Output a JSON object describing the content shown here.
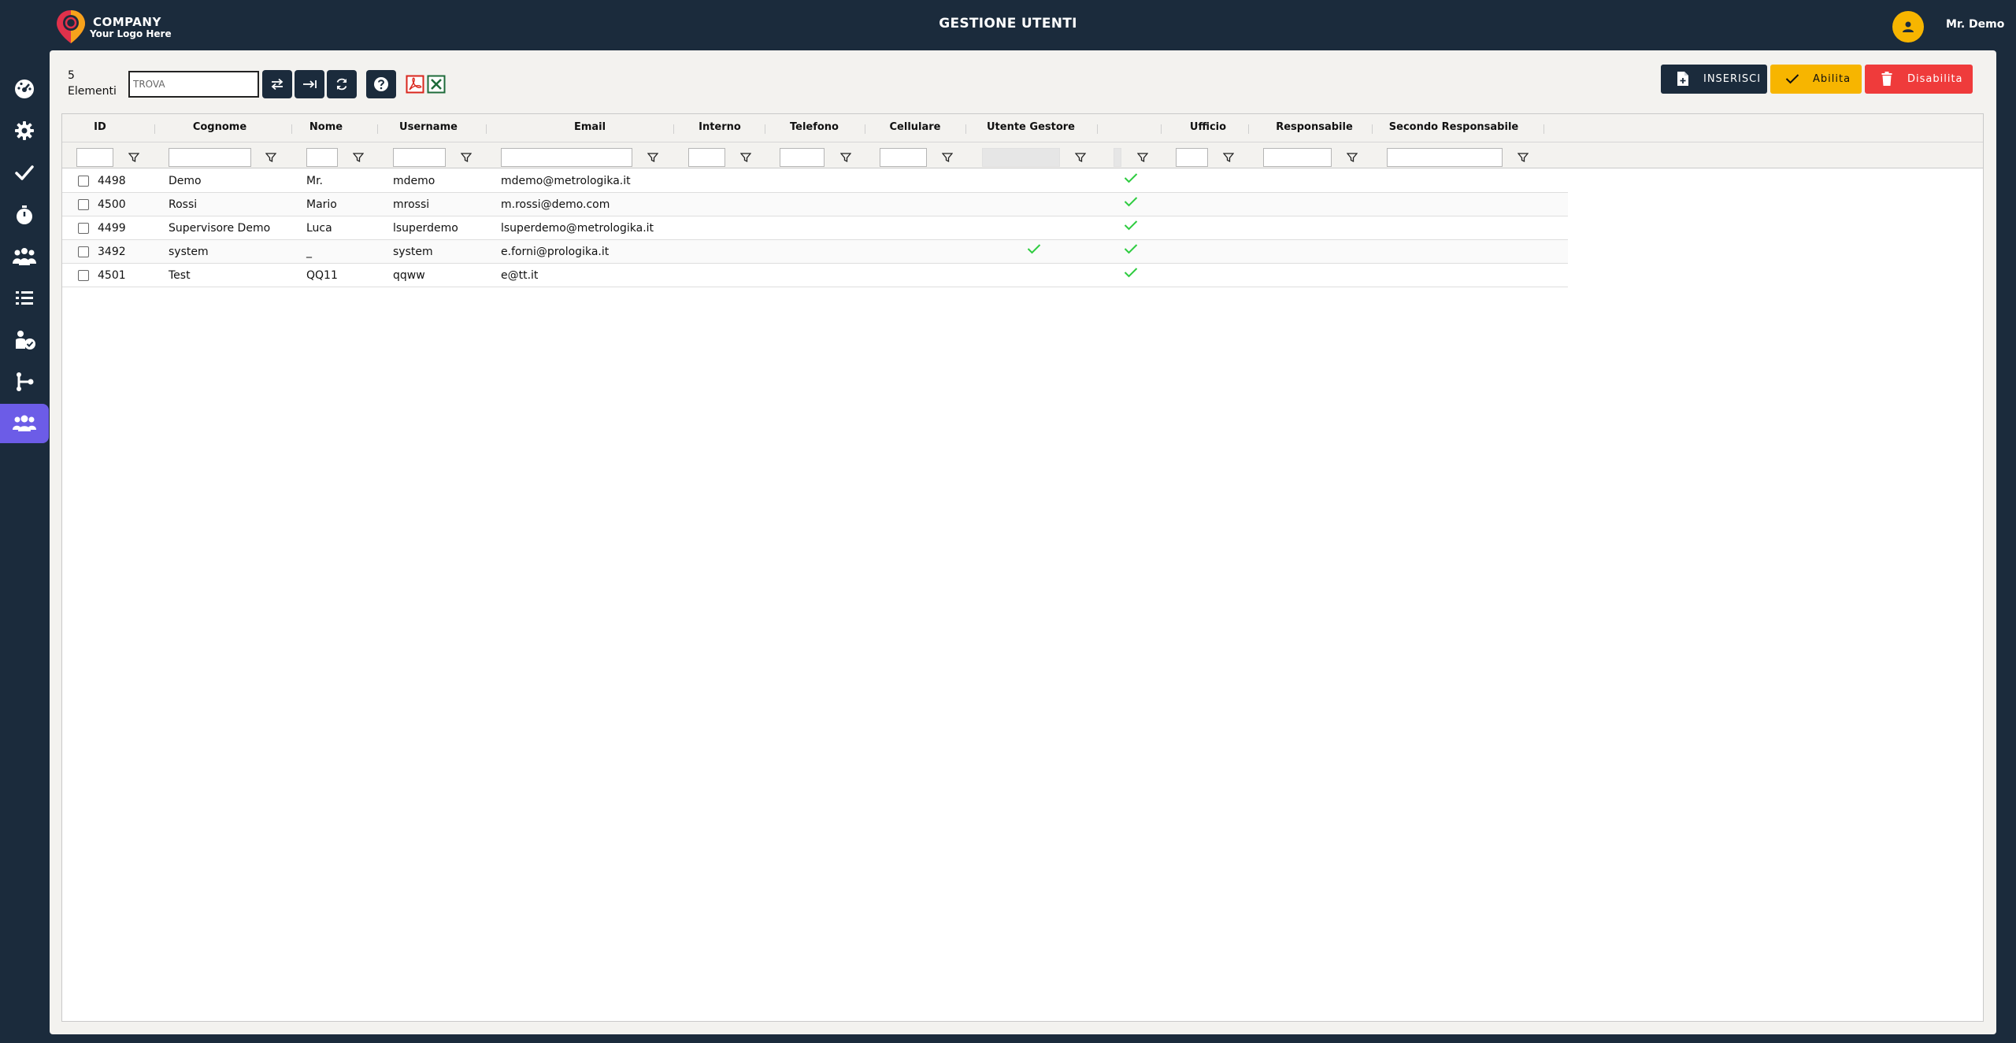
{
  "header": {
    "company": "COMPANY",
    "logo_tagline": "Your Logo Here",
    "title": "GESTIONE UTENTI",
    "user_name": "Mr. Demo"
  },
  "sidebar": {
    "items": [
      {
        "icon": "dashboard-icon"
      },
      {
        "icon": "gear-icon"
      },
      {
        "icon": "check-icon"
      },
      {
        "icon": "stopwatch-icon"
      },
      {
        "icon": "group-icon"
      },
      {
        "icon": "list-icon"
      },
      {
        "icon": "user-check-icon"
      },
      {
        "icon": "workflow-icon"
      },
      {
        "icon": "users-icon",
        "active": true
      }
    ]
  },
  "toolbar": {
    "count_number": "5",
    "count_label": "Elementi",
    "search_placeholder": "TROVA",
    "insert_label": "INSERISCI",
    "enable_label": "Abilita",
    "disable_label": "Disabilita"
  },
  "table": {
    "columns": [
      "ID",
      "Cognome",
      "Nome",
      "Username",
      "Email",
      "Interno",
      "Telefono",
      "Cellulare",
      "Utente Gestore",
      "",
      "Ufficio",
      "Responsabile",
      "Secondo Responsabile"
    ],
    "rows": [
      {
        "id": "4498",
        "cognome": "Demo",
        "nome": "Mr.",
        "username": "mdemo",
        "email": "mdemo@metrologika.it",
        "gestore": false,
        "abilitato": true
      },
      {
        "id": "4500",
        "cognome": "Rossi",
        "nome": "Mario",
        "username": "mrossi",
        "email": "m.rossi@demo.com",
        "gestore": false,
        "abilitato": true
      },
      {
        "id": "4499",
        "cognome": "Supervisore Demo",
        "nome": "Luca",
        "username": "lsuperdemo",
        "email": "lsuperdemo@metrologika.it",
        "gestore": false,
        "abilitato": true
      },
      {
        "id": "3492",
        "cognome": "system",
        "nome": "_",
        "username": "system",
        "email": "e.forni@prologika.it",
        "gestore": true,
        "abilitato": true
      },
      {
        "id": "4501",
        "cognome": "Test",
        "nome": "QQ11",
        "username": "qqww",
        "email": "e@tt.it",
        "gestore": false,
        "abilitato": true
      }
    ]
  },
  "colors": {
    "navy": "#1b2b3c",
    "accent_purple": "#6c5ce7",
    "yellow": "#f7b500",
    "red": "#ef3b3b",
    "check_green": "#2ecc40"
  }
}
